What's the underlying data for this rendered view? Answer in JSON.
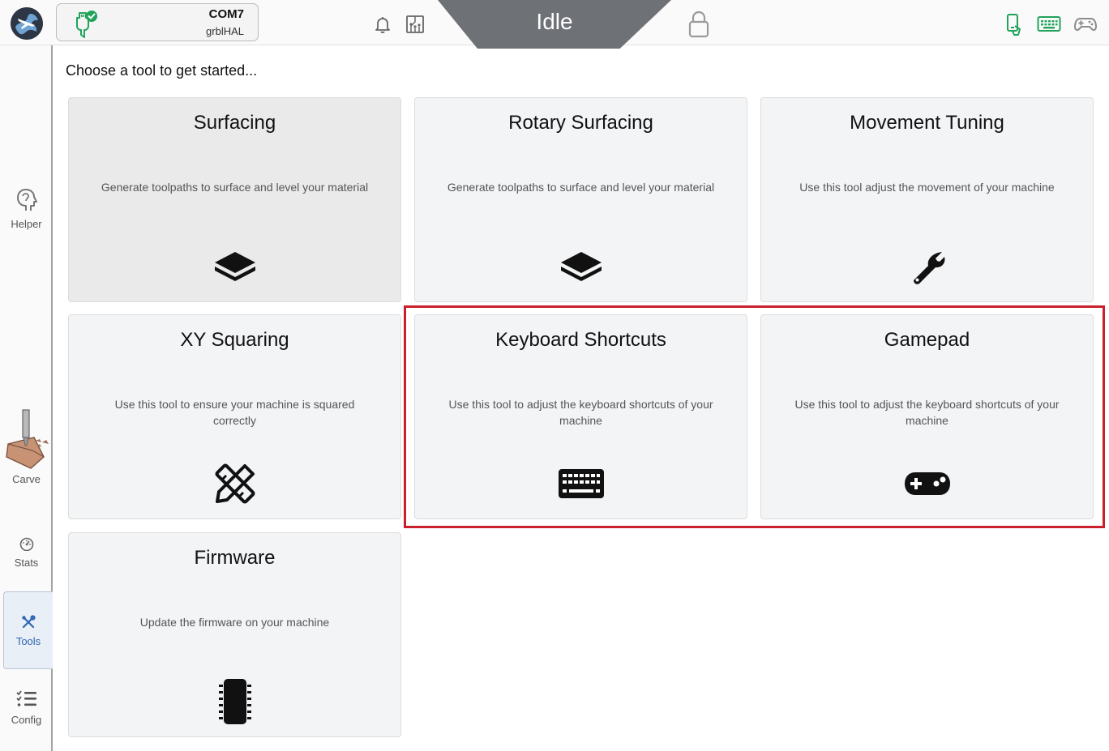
{
  "header": {
    "connection": {
      "port": "COM7",
      "firmware": "grblHAL"
    },
    "machine_state": "Idle",
    "icons": [
      "app-logo-icon",
      "usb-connected-icon",
      "bell-icon",
      "circuit-board-icon",
      "lock-icon",
      "phone-icon",
      "keyboard-icon",
      "gamepad-icon"
    ],
    "accent_color": "#21a35a"
  },
  "sidebar": {
    "items": [
      {
        "label": "Helper",
        "icon": "helper-icon"
      },
      {
        "label": "Carve",
        "icon": "carve-icon"
      },
      {
        "label": "Stats",
        "icon": "gauge-icon"
      },
      {
        "label": "Tools",
        "icon": "tools-icon",
        "active": true
      },
      {
        "label": "Config",
        "icon": "checklist-icon"
      }
    ]
  },
  "main": {
    "heading": "Choose a tool to get started...",
    "tools": [
      {
        "title": "Surfacing",
        "description": "Generate toolpaths to surface and level your material",
        "icon": "surface-block-icon"
      },
      {
        "title": "Rotary Surfacing",
        "description": "Generate toolpaths to surface and level your material",
        "icon": "surface-block-icon"
      },
      {
        "title": "Movement Tuning",
        "description": "Use this tool adjust the movement of your machine",
        "icon": "wrench-icon"
      },
      {
        "title": "XY Squaring",
        "description": "Use this tool to ensure your machine is squared correctly",
        "icon": "ruler-pencil-icon"
      },
      {
        "title": "Keyboard Shortcuts",
        "description": "Use this tool to adjust the keyboard shortcuts of your machine",
        "icon": "keyboard-icon"
      },
      {
        "title": "Gamepad",
        "description": "Use this tool to adjust the keyboard shortcuts of your machine",
        "icon": "gamepad-icon"
      },
      {
        "title": "Firmware",
        "description": "Update the firmware on your machine",
        "icon": "chip-icon"
      }
    ]
  },
  "highlight_color": "#c9202b"
}
